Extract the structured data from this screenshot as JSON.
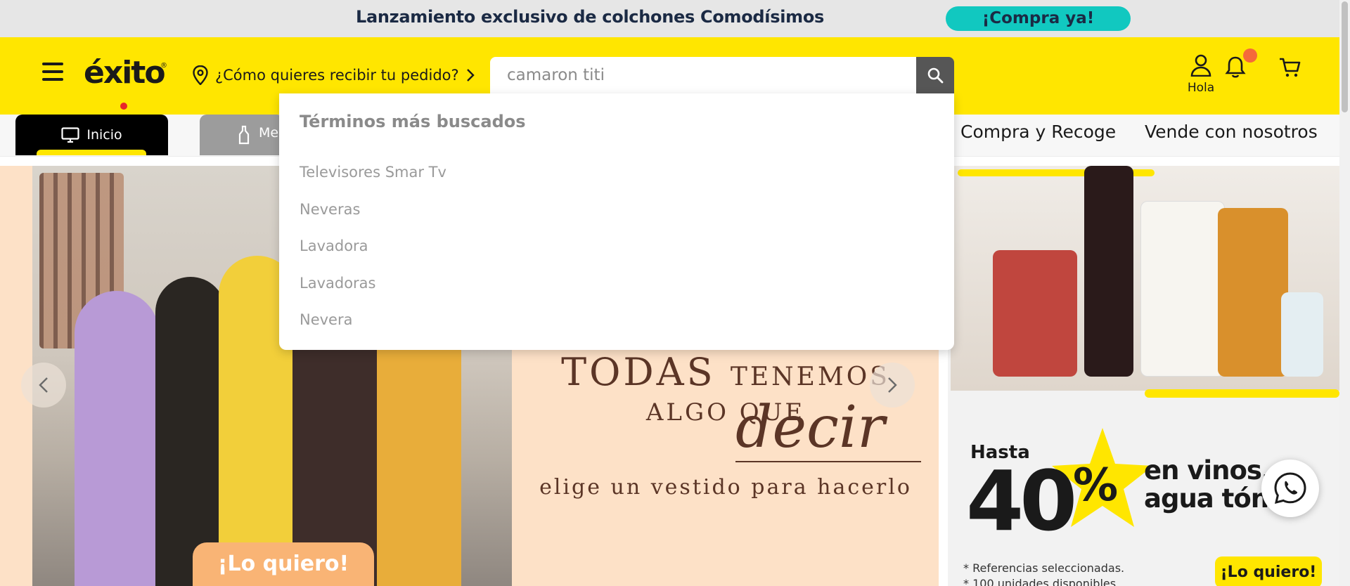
{
  "promo_bar": {
    "text": "Lanzamiento exclusivo de colchones Comodísimos",
    "cta": "¡Compra ya!"
  },
  "header": {
    "logo_text": "éxito",
    "logo_reg": "®",
    "delivery_label": "¿Cómo quieres recibir tu pedido?",
    "search": {
      "value": "camaron titi",
      "placeholder": ""
    },
    "user_label": "Hola",
    "icons": [
      "menu-icon",
      "location-pin-icon",
      "chevron-right-icon",
      "search-icon",
      "user-icon",
      "bell-icon",
      "cart-icon"
    ]
  },
  "nav": {
    "active_tab": "Inicio",
    "second_tab": "Me",
    "links": [
      "Compra y Recoge",
      "Vende con nosotros"
    ]
  },
  "dropdown": {
    "title": "Términos más buscados",
    "items": [
      "Televisores Smar Tv",
      "Neveras",
      "Lavadora",
      "Lavadoras",
      "Nevera"
    ]
  },
  "hero": {
    "title_big": "TODAS",
    "title_small": "TENEMOS",
    "line2": "ALGO QUE",
    "script": "decir",
    "subtitle": "elige un vestido para hacerlo",
    "cta": "¡Lo quiero!"
  },
  "promo_panel": {
    "hasta": "Hasta",
    "value": "40",
    "pct": "%",
    "line1": "en vinos, ro",
    "line2": "agua tónic",
    "note1": "* Referencias seleccionadas.",
    "note2": "* 100 unidades disponibles",
    "cta": "¡Lo quiero!"
  },
  "colors": {
    "brand_yellow": "#ffe600",
    "promo_cyan": "#11c8c0",
    "search_button": "#565656",
    "notification_dot": "#f56a3a"
  }
}
